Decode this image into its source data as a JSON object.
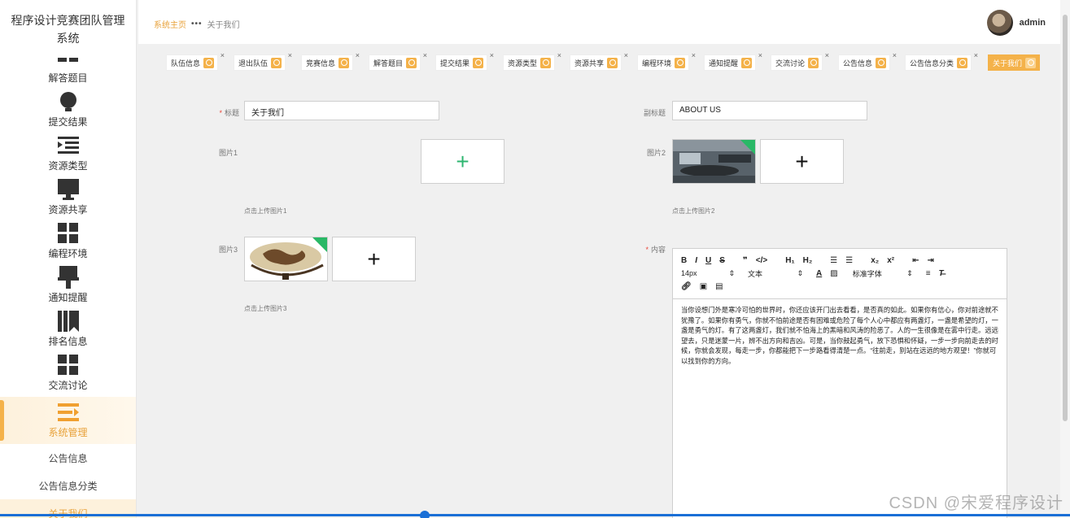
{
  "app": {
    "title": "程序设计竞赛团队管理系统"
  },
  "sidebar": {
    "items": [
      {
        "label": "解答题目",
        "icon": "grid-icon"
      },
      {
        "label": "提交结果",
        "icon": "bulb-icon"
      },
      {
        "label": "资源类型",
        "icon": "list-indent-icon"
      },
      {
        "label": "资源共享",
        "icon": "monitor-icon"
      },
      {
        "label": "编程环境",
        "icon": "grid-icon"
      },
      {
        "label": "通知提醒",
        "icon": "brush-icon"
      },
      {
        "label": "排名信息",
        "icon": "book-icon"
      },
      {
        "label": "交流讨论",
        "icon": "grid-icon"
      },
      {
        "label": "系统管理",
        "icon": "menu-icon"
      }
    ],
    "subitems": [
      {
        "label": "公告信息"
      },
      {
        "label": "公告信息分类"
      },
      {
        "label": "关于我们"
      }
    ]
  },
  "header": {
    "breadcrumb_home": "系统主页",
    "breadcrumb_current": "关于我们",
    "username": "admin"
  },
  "tabs": [
    {
      "label": "队伍信息"
    },
    {
      "label": "退出队伍"
    },
    {
      "label": "竞赛信息"
    },
    {
      "label": "解答题目"
    },
    {
      "label": "提交结果"
    },
    {
      "label": "资源类型"
    },
    {
      "label": "资源共享"
    },
    {
      "label": "编程环境"
    },
    {
      "label": "通知提醒"
    },
    {
      "label": "交流讨论"
    },
    {
      "label": "公告信息"
    },
    {
      "label": "公告信息分类"
    },
    {
      "label": "关于我们"
    }
  ],
  "form": {
    "title_label": "标题",
    "title_value": "关于我们",
    "subtitle_label": "副标题",
    "subtitle_value": "ABOUT US",
    "pic1_label": "图片1",
    "pic1_hint": "点击上传图片1",
    "pic2_label": "图片2",
    "pic2_hint": "点击上传图片2",
    "pic3_label": "图片3",
    "pic3_hint": "点击上传图片3",
    "content_label": "内容"
  },
  "editor": {
    "font_size": "14px",
    "text_type": "文本",
    "font_family": "标准字体",
    "content": "当你设想门外是寒冷可怕的世界时，你还应该开门出去看看，是否真的如此。如果你有信心，你对前途就不犹豫了。如果你有勇气，你就不怕前途是否有困难或危险了每个人心中都应有两盏灯，一盏是希望的灯，一盏是勇气的灯。有了这两盏灯，我们就不怕海上的黑暗和风涛的险恶了。人的一生很像是在雾中行走。远远望去，只是迷蒙一片，辨不出方向和吉凶。可是，当你鼓起勇气，放下恐惧和怀疑，一步一步向前走去的时候，你就会发现，每走一步，你都能把下一步路看得清楚一点。“往前走，别站在远远的地方观望！”你就可以找到你的方向。"
  },
  "watermark": "CSDN @宋爱程序设计"
}
